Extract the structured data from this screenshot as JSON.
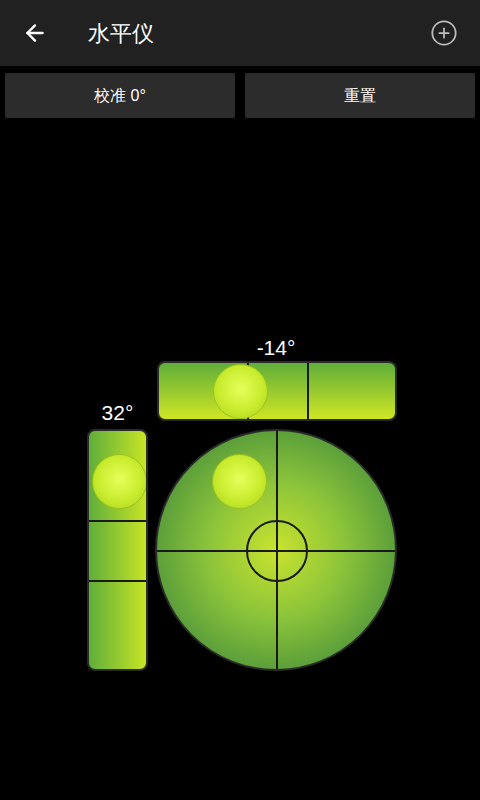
{
  "top_bar": {
    "title": "水平仪"
  },
  "buttons": [
    {
      "label": "校准 0°"
    },
    {
      "label": "重置"
    }
  ],
  "horizontal_level": {
    "reading": "-14°",
    "level": 0.34
  },
  "vertical_level": {
    "reading": "32°",
    "level": 0.21
  },
  "bubble_level": {
    "x_level": 0.34,
    "y_level": 0.21
  }
}
